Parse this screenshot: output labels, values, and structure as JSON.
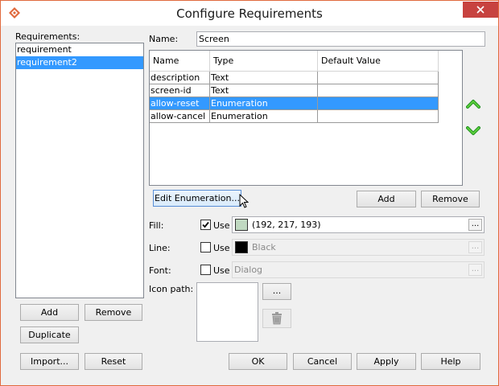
{
  "window": {
    "title": "Configure Requirements",
    "accent_color": "#e06a3e"
  },
  "requirements": {
    "label": "Requirements:",
    "items": [
      {
        "label": "requirement",
        "selected": false
      },
      {
        "label": "requirement2",
        "selected": true
      }
    ],
    "add_label": "Add",
    "remove_label": "Remove",
    "duplicate_label": "Duplicate"
  },
  "name": {
    "label": "Name:",
    "value": "Screen"
  },
  "table": {
    "headers": [
      "Name",
      "Type",
      "Default Value"
    ],
    "rows": [
      {
        "name": "description",
        "type": "Text",
        "default": "",
        "selected": false
      },
      {
        "name": "screen-id",
        "type": "Text",
        "default": "",
        "selected": false
      },
      {
        "name": "allow-reset",
        "type": "Enumeration",
        "default": "",
        "selected": true
      },
      {
        "name": "allow-cancel",
        "type": "Enumeration",
        "default": "",
        "selected": false
      }
    ]
  },
  "table_actions": {
    "edit_enum_label": "Edit Enumeration...",
    "add_label": "Add",
    "remove_label": "Remove",
    "move_up_icon": "green-up-chevron-icon",
    "move_down_icon": "green-down-chevron-icon"
  },
  "fill": {
    "label": "Fill:",
    "use_label": "Use",
    "checked": true,
    "value": "(192, 217, 193)",
    "swatch_color": "#c0d9c1",
    "dots_label": "..."
  },
  "line": {
    "label": "Line:",
    "use_label": "Use",
    "checked": false,
    "value": "Black",
    "swatch_color": "#000000",
    "dots_label": "..."
  },
  "font": {
    "label": "Font:",
    "use_label": "Use",
    "checked": false,
    "value": "Dialog",
    "dots_label": "..."
  },
  "icon_path": {
    "label": "Icon path:",
    "browse_label": "...",
    "delete_icon": "trash-icon"
  },
  "footer": {
    "import_label": "Import...",
    "reset_label": "Reset",
    "ok_label": "OK",
    "cancel_label": "Cancel",
    "apply_label": "Apply",
    "help_label": "Help"
  }
}
